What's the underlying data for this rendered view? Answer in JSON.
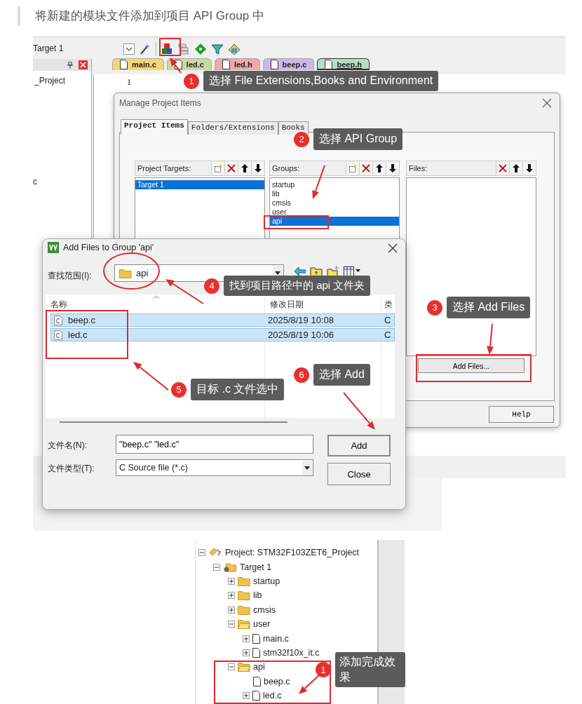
{
  "heading": "将新建的模块文件添加到项目 API Group 中",
  "ide": {
    "target": "Target 1",
    "project_label": "_Project",
    "side_letter": "c",
    "line_number": "1",
    "editor_tabs": [
      {
        "label": "main.c",
        "color": "#f7d774",
        "selected": false
      },
      {
        "label": "led.c",
        "color": "#c9d9a2",
        "selected": false
      },
      {
        "label": "led.h",
        "color": "#f0a8a8",
        "selected": false
      },
      {
        "label": "beep.c",
        "color": "#c9b9e8",
        "selected": false
      },
      {
        "label": "beep.h",
        "color": "#b9dcc9",
        "selected": true
      }
    ]
  },
  "manage_dialog": {
    "title": "Manage Project Items",
    "tabs": [
      {
        "label": "Project Items",
        "selected": true
      },
      {
        "label": "Folders/Extensions",
        "selected": false
      },
      {
        "label": "Books",
        "selected": false
      }
    ],
    "panels": [
      {
        "title": "Project Targets:",
        "items": [
          {
            "label": "Target 1",
            "selected": true
          }
        ]
      },
      {
        "title": "Groups:",
        "items": [
          {
            "label": "startup",
            "selected": false
          },
          {
            "label": "lib",
            "selected": false
          },
          {
            "label": "cmsis",
            "selected": false
          },
          {
            "label": "user",
            "selected": false
          },
          {
            "label": "api",
            "selected": true
          }
        ]
      },
      {
        "title": "Files:"
      }
    ],
    "add_files_button": "Add Files...",
    "help_button": "Help"
  },
  "add_dialog": {
    "title": "Add Files to Group 'api'",
    "look_in_label": "查找范围(I):",
    "look_in_value": "api",
    "columns": [
      "名称",
      "修改日期",
      "类"
    ],
    "files": [
      {
        "name": "beep.c",
        "modified": "2025/8/19 10:08",
        "type": "C",
        "selected": true
      },
      {
        "name": "led.c",
        "modified": "2025/8/19 10:06",
        "type": "C",
        "selected": true
      }
    ],
    "filename_label": "文件名(N):",
    "filename_value": "\"beep.c\" \"led.c\"",
    "filetype_label": "文件类型(T):",
    "filetype_value": "C Source file (*.c)",
    "buttons": [
      "Add",
      "Close"
    ]
  },
  "callouts": [
    {
      "number": "1",
      "text": "选择 File Extensions,Books and Environment"
    },
    {
      "number": "2",
      "text": "选择 API Group"
    },
    {
      "number": "3",
      "text": "选择 Add Files"
    },
    {
      "number": "4",
      "text": "找到项目路径中的 api 文件夹"
    },
    {
      "number": "5",
      "text": "目标 .c 文件选中"
    },
    {
      "number": "6",
      "text": "选择 Add"
    }
  ],
  "tree": {
    "label": "Project: STM32F103ZET6_Project",
    "kind": "project",
    "expanded": true,
    "children": [
      {
        "label": "Target 1",
        "kind": "target",
        "expanded": true,
        "children": [
          {
            "label": "startup",
            "kind": "folder",
            "expanded": false
          },
          {
            "label": "lib",
            "kind": "folder",
            "expanded": false
          },
          {
            "label": "cmsis",
            "kind": "folder",
            "expanded": false
          },
          {
            "label": "user",
            "kind": "folder",
            "expanded": true,
            "children": [
              {
                "label": "main.c",
                "kind": "file",
                "expanded": false
              },
              {
                "label": "stm32f10x_it.c",
                "kind": "file",
                "expanded": false
              }
            ]
          },
          {
            "label": "api",
            "kind": "folder",
            "expanded": true,
            "children": [
              {
                "label": "beep.c",
                "kind": "leaf"
              },
              {
                "label": "led.c",
                "kind": "file",
                "expanded": false
              }
            ]
          }
        ]
      }
    ]
  },
  "tree_callout": {
    "number": "1",
    "text": "添加完成效果"
  }
}
